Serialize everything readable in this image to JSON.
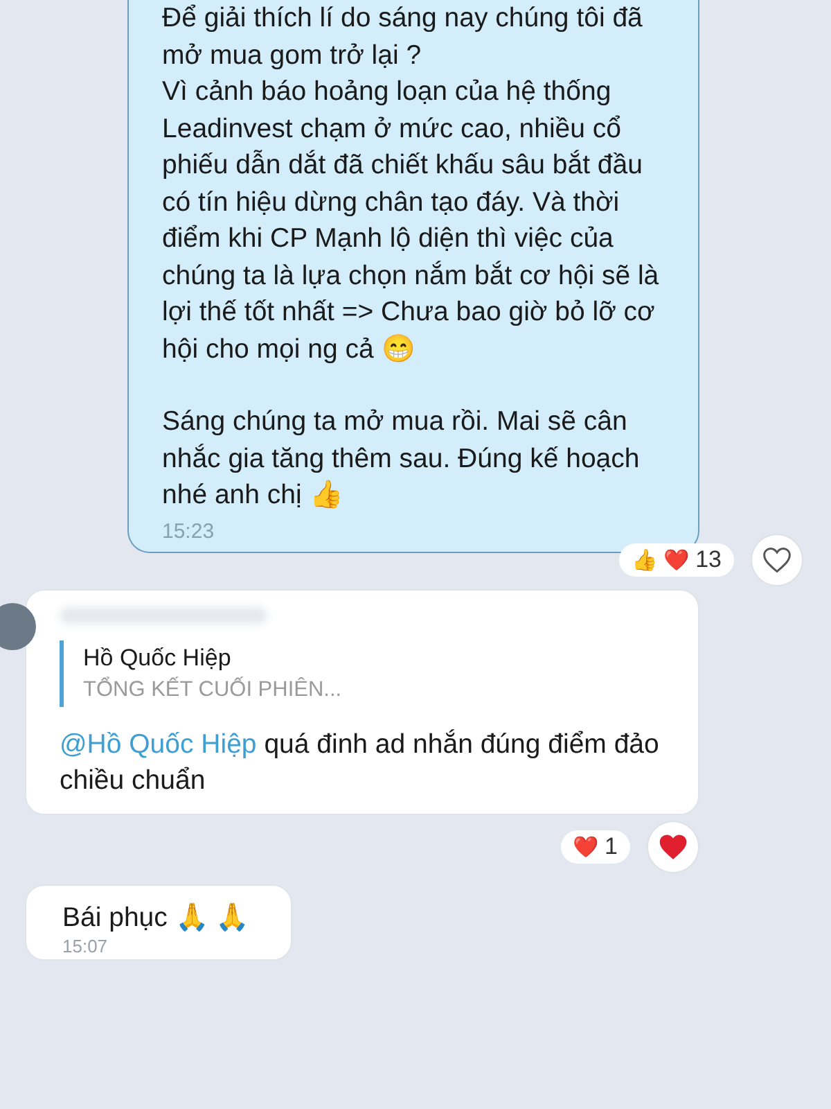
{
  "messages": [
    {
      "kind": "outgoing",
      "paragraphs": [
        "Để giải thích lí do sáng nay chúng tôi đã mở mua gom trở lại ?",
        "Vì cảnh báo hoảng loạn của hệ thống Leadinvest chạm ở mức cao, nhiều cổ phiếu dẫn dắt đã chiết khấu sâu bắt đầu có tín hiệu dừng chân tạo đáy. Và thời điểm khi CP Mạnh lộ diện thì việc của chúng ta là lựa chọn nắm bắt cơ hội sẽ là lợi thế tốt nhất => Chưa bao giờ bỏ lỡ cơ hội cho mọi ng cả 😁",
        "Sáng chúng ta mở mua rồi. Mai sẽ cân nhắc gia tăng thêm sau. Đúng kế hoạch nhé anh chị 👍"
      ],
      "time": "15:23",
      "reactions": {
        "emojis": [
          "👍",
          "❤️"
        ],
        "count": "13",
        "reacted": false
      }
    },
    {
      "kind": "incoming",
      "avatar": true,
      "quote": {
        "author": "Hồ Quốc Hiệp",
        "text": "TỔNG KẾT CUỐI PHIÊN..."
      },
      "mention": "@Hồ Quốc Hiệp",
      "text": " quá đinh ad nhắn đúng điểm đảo chiều chuẩn",
      "reactions": {
        "emojis": [
          "❤️"
        ],
        "count": "1",
        "reacted": true
      }
    },
    {
      "kind": "incoming",
      "avatar": false,
      "text": "Bái phục 🙏 🙏",
      "time": "15:07"
    }
  ]
}
